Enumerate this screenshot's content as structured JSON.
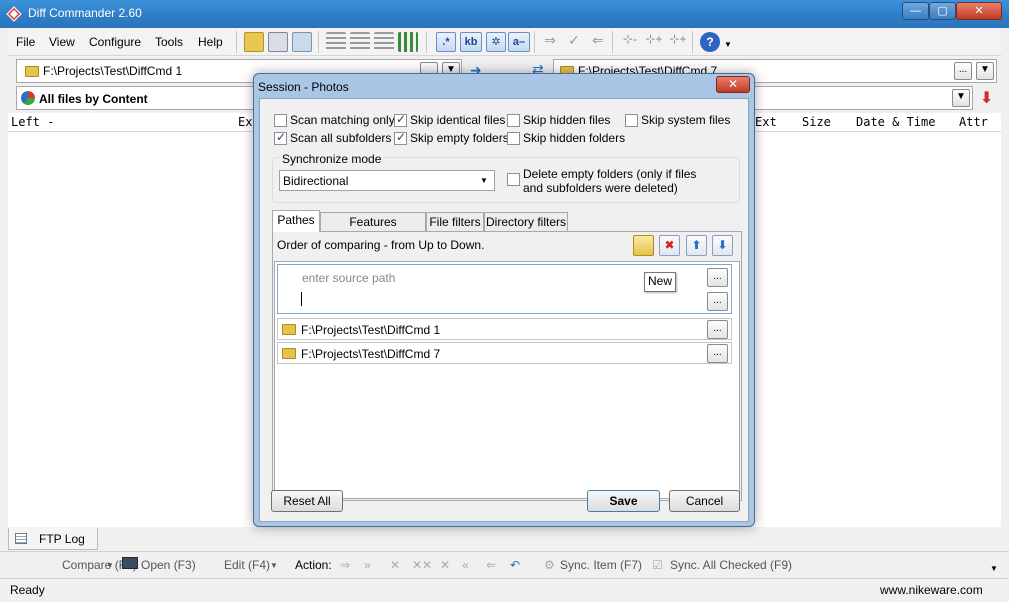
{
  "window": {
    "title": "Diff Commander 2.60"
  },
  "menu": [
    "File",
    "View",
    "Configure",
    "Tools",
    "Help"
  ],
  "toolbar": {
    "regex_label": ".*",
    "kb_label": "kb",
    "asc_label": "a–"
  },
  "left_path": "F:\\Projects\\Test\\DiffCmd 1",
  "right_path": "F:\\Projects\\Test\\DiffCmd 7",
  "filter": "All files by Content",
  "columns": {
    "left": "Left -",
    "ext": "Ext",
    "size": "Size",
    "date": "Date & Time",
    "attr": "Attr",
    "ext_right": "Ext"
  },
  "ftp_tab": "FTP Log",
  "bottom": {
    "compare": "Compare (F2)",
    "open": "Open (F3)",
    "edit": "Edit (F4)",
    "action": "Action:",
    "sync_item": "Sync. Item (F7)",
    "sync_all": "Sync. All Checked (F9)"
  },
  "status": {
    "left": "Ready",
    "right": "www.nikeware.com"
  },
  "dialog": {
    "title": "Session - Photos",
    "checkboxes": {
      "scan_matching": {
        "label": "Scan matching only",
        "checked": false
      },
      "skip_identical": {
        "label": "Skip identical files",
        "checked": true
      },
      "skip_hidden_files": {
        "label": "Skip hidden files",
        "checked": false
      },
      "skip_system_files": {
        "label": "Skip system files",
        "checked": false
      },
      "scan_subfolders": {
        "label": "Scan all subfolders",
        "checked": true
      },
      "skip_empty_folders": {
        "label": "Skip empty folders",
        "checked": true
      },
      "skip_hidden_folders": {
        "label": "Skip hidden folders",
        "checked": false
      }
    },
    "sync_mode_label": "Synchronize mode",
    "sync_mode_value": "Bidirectional",
    "delete_empty_line1": "Delete empty folders (only if files",
    "delete_empty_line2": "and subfolders were deleted)",
    "tabs": [
      "Pathes",
      "Features comparing",
      "File filters",
      "Directory filters"
    ],
    "order_text": "Order of comparing - from Up to Down.",
    "source_placeholder": "enter source path",
    "tooltip": "New",
    "paths": [
      "F:\\Projects\\Test\\DiffCmd 1",
      "F:\\Projects\\Test\\DiffCmd 7"
    ],
    "buttons": {
      "reset": "Reset All",
      "save": "Save",
      "cancel": "Cancel"
    },
    "dots_label": "..."
  }
}
